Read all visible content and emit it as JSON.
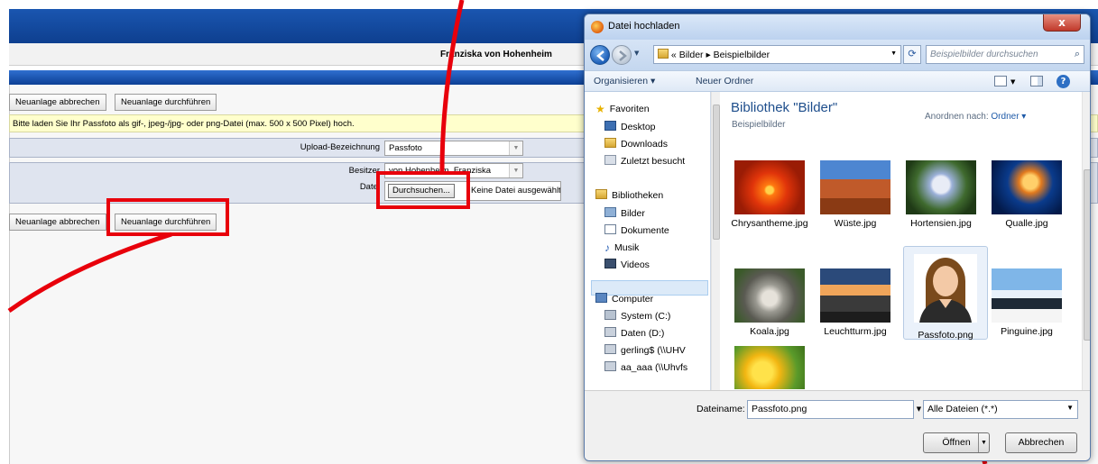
{
  "page": {
    "user_name": "Franziska von Hohenheim",
    "btn_cancel_new": "Neuanlage abbrechen",
    "btn_do_new": "Neuanlage durchführen",
    "info_text": "Bitte laden Sie Ihr Passfoto als gif-, jpeg-/jpg- oder png-Datei (max. 500 x 500 Pixel) hoch.",
    "upload_label": "Upload-Bezeichnung",
    "upload_value": "Passfoto",
    "owner_label": "Besitzer",
    "owner_value": "von Hohenheim, Franziska",
    "file_label": "Datei",
    "browse_button": "Durchsuchen...",
    "no_file_text": "Keine Datei ausgewählt."
  },
  "dialog": {
    "title": "Datei hochladen",
    "close_glyph": "x",
    "breadcrumb": [
      "«",
      "Bilder",
      "▸",
      "Beispielbilder"
    ],
    "search_placeholder": "Beispielbilder durchsuchen",
    "toolbar": {
      "organize": "Organisieren ▾",
      "new_folder": "Neuer Ordner"
    },
    "nav": {
      "favorites_header": "Favoriten",
      "favorites": [
        "Desktop",
        "Downloads",
        "Zuletzt besucht"
      ],
      "libraries_header": "Bibliotheken",
      "libraries": [
        "Bilder",
        "Dokumente",
        "Musik",
        "Videos"
      ],
      "computer_header": "Computer",
      "drives": [
        "System (C:)",
        "Daten (D:)",
        "gerling$ (\\\\UHV",
        "aa_aaa (\\\\Uhvfs"
      ]
    },
    "library_title": "Bibliothek \"Bilder\"",
    "library_subtitle": "Beispielbilder",
    "arrange_label": "Anordnen nach:",
    "arrange_value": "Ordner ▾",
    "files": [
      {
        "name": "Chrysantheme.jpg",
        "icon": "chrysanthemum-photo"
      },
      {
        "name": "Wüste.jpg",
        "icon": "desert-photo"
      },
      {
        "name": "Hortensien.jpg",
        "icon": "hydrangea-photo"
      },
      {
        "name": "Qualle.jpg",
        "icon": "jellyfish-photo"
      },
      {
        "name": "Koala.jpg",
        "icon": "koala-photo"
      },
      {
        "name": "Leuchtturm.jpg",
        "icon": "lighthouse-photo"
      },
      {
        "name": "Passfoto.png",
        "icon": "avatar-photo"
      },
      {
        "name": "Pinguine.jpg",
        "icon": "penguins-photo"
      },
      {
        "name": "",
        "icon": "tulips-photo"
      }
    ],
    "filename_label": "Dateiname:",
    "filename_value": "Passfoto.png",
    "filter_value": "Alle Dateien (*.*)",
    "open_button": "Öffnen",
    "cancel_button": "Abbrechen"
  },
  "colors": {
    "accent_blue": "#0e3f8f",
    "highlight_red": "#e8000b",
    "info_yellow": "#ffffcc"
  }
}
